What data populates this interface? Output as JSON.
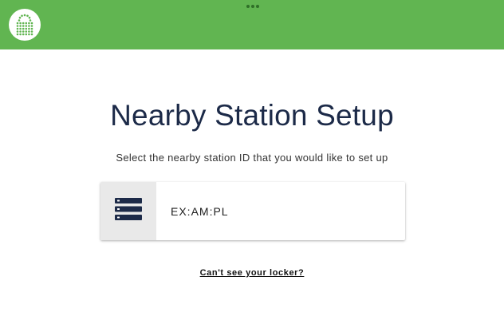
{
  "colors": {
    "brand_green": "#61b551",
    "title_navy": "#1c2a48",
    "icon_navy": "#1c2a48"
  },
  "header": {
    "logo_icon": "locker-logo-icon",
    "menu_icon": "more-horizontal-icon"
  },
  "main": {
    "title": "Nearby Station Setup",
    "subtitle": "Select the nearby station ID that you would like to set up",
    "stations": [
      {
        "icon": "server-stack-icon",
        "id": "EX:AM:PL"
      }
    ],
    "help_link": "Can't see your locker?"
  }
}
